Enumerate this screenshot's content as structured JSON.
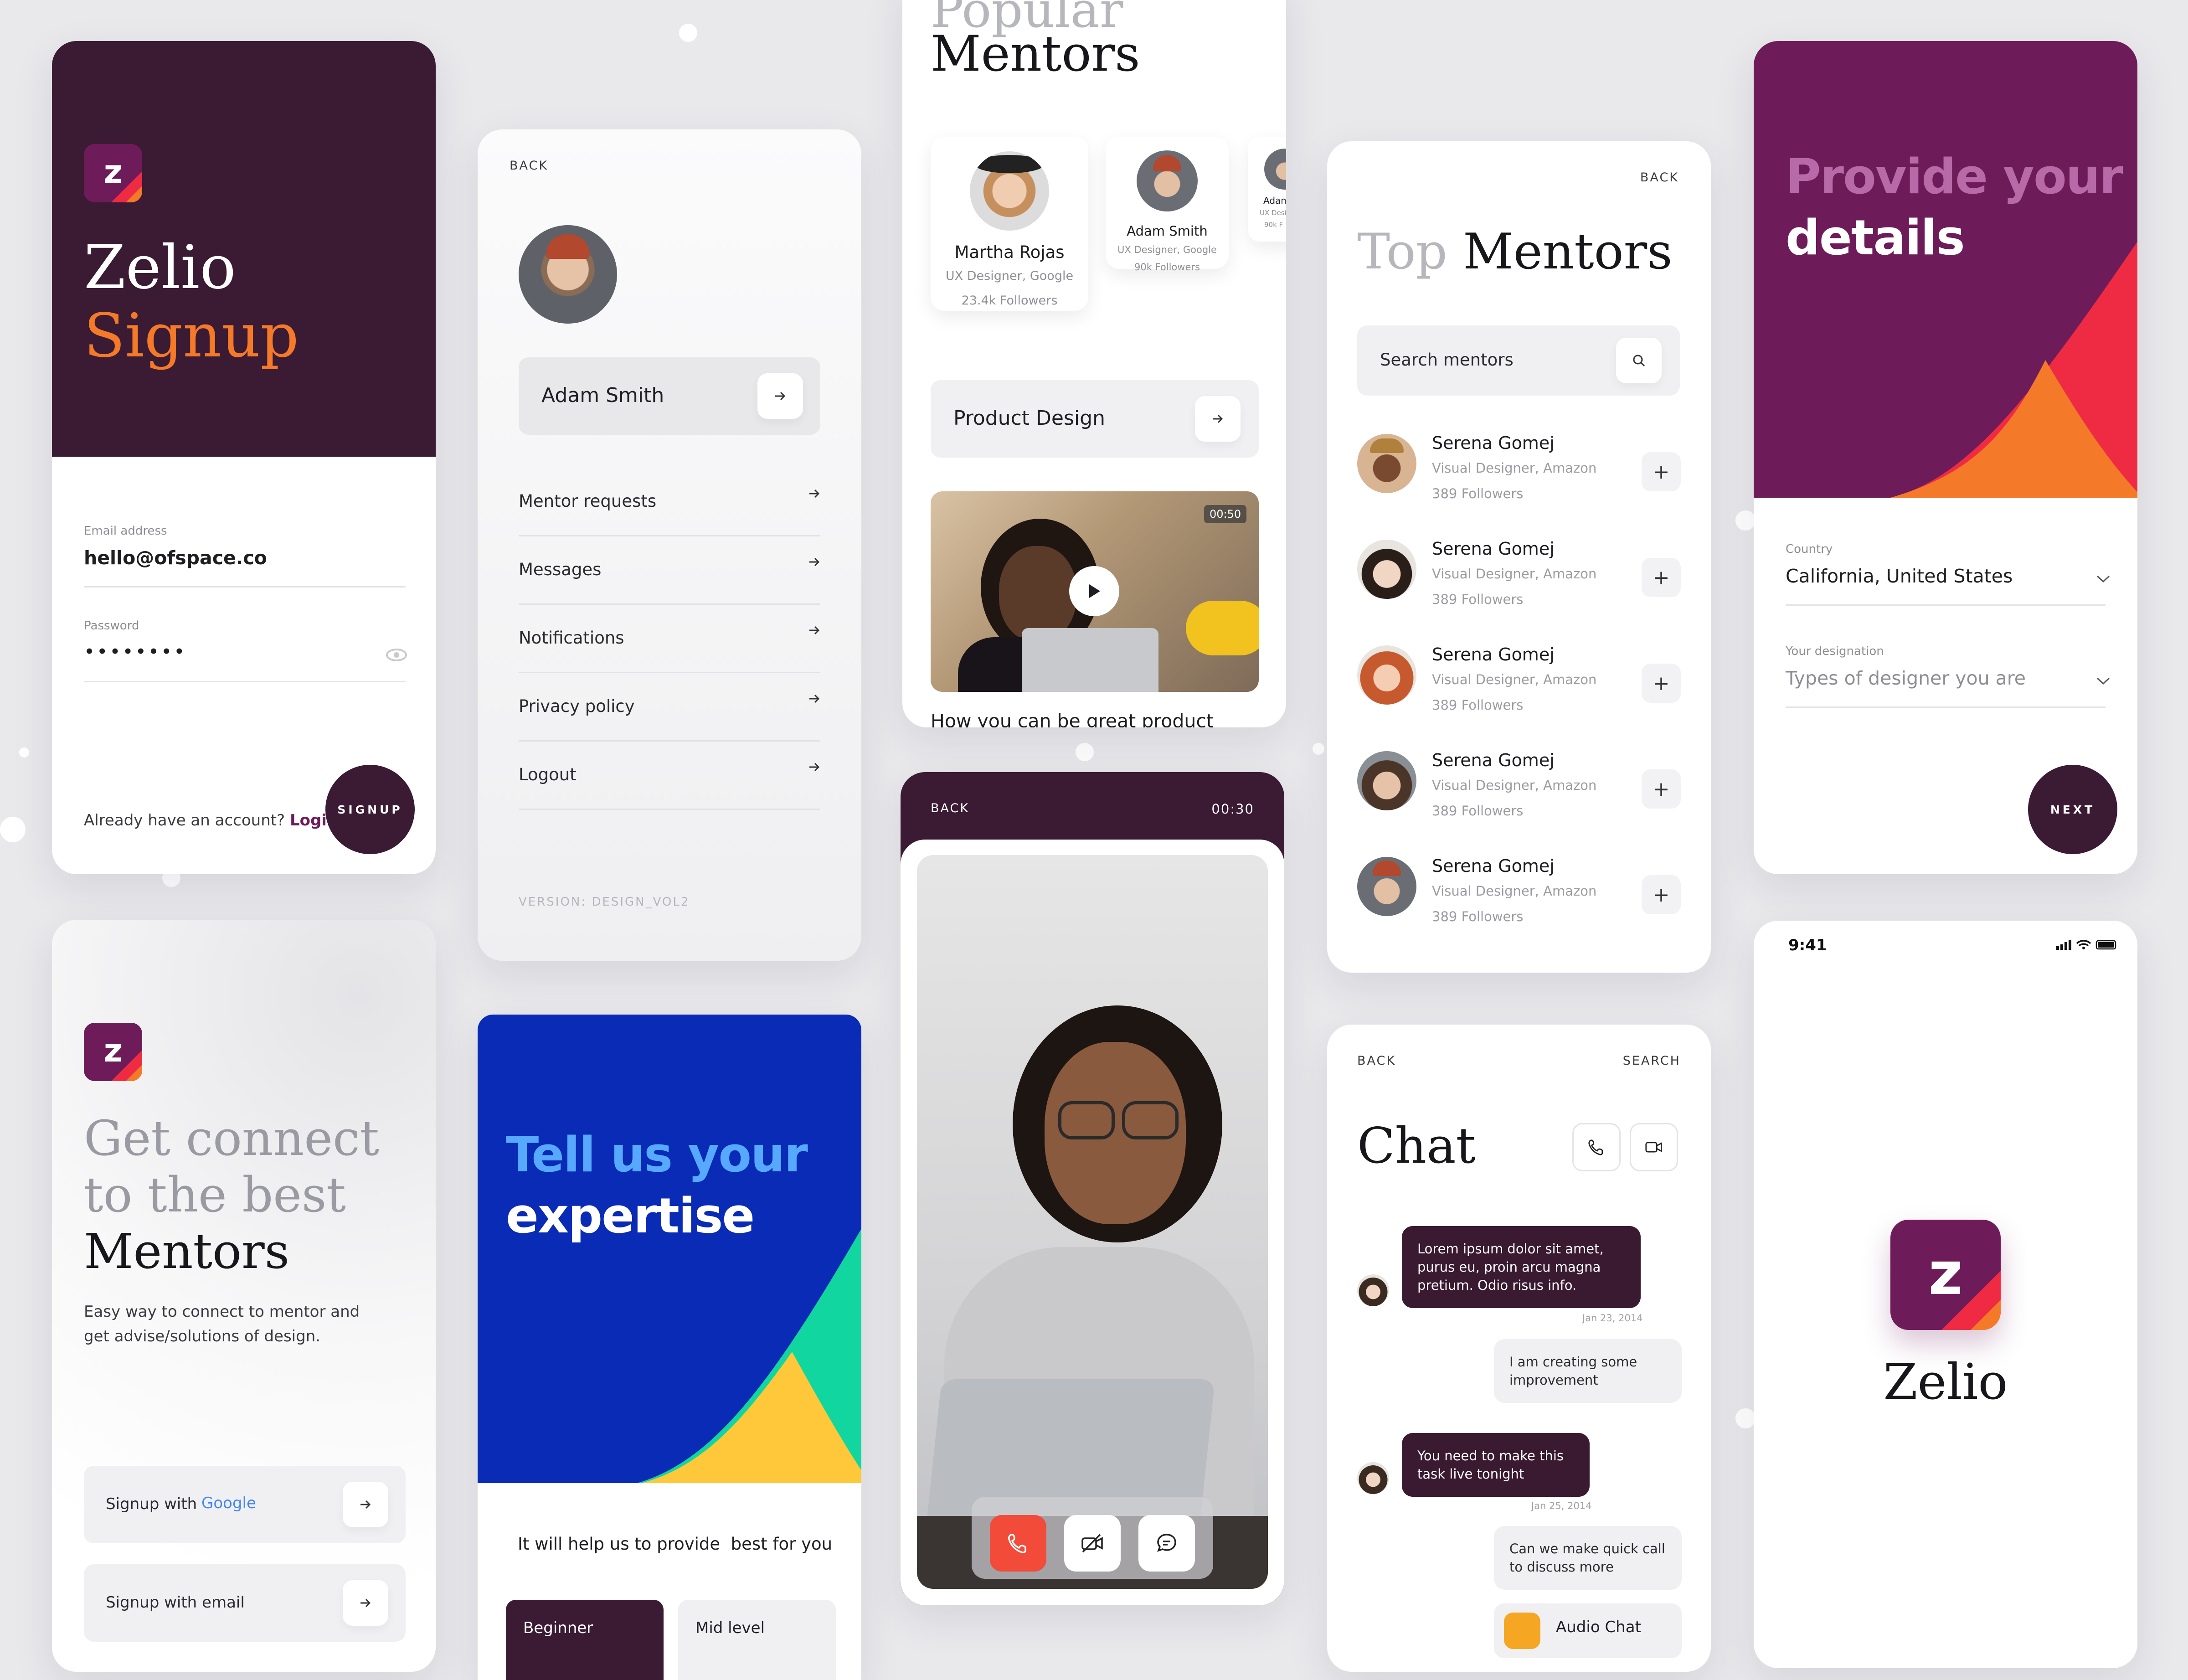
{
  "colors": {
    "plum": "#3b1a33",
    "orange": "#f47a2a",
    "purple": "#6e1b5a",
    "red": "#ef2b43",
    "blue": "#0a2bb5",
    "teal": "#12d6a0",
    "yellow": "#ffc83a",
    "call_red": "#f24b3a"
  },
  "signup": {
    "logo_letter": "z",
    "title_line1": "Zelio",
    "title_line2": "Signup",
    "email_label": "Email address",
    "email_value": "hello@ofspace.co",
    "password_label": "Password",
    "password_value": "••••••••",
    "already_text": "Already have an account?",
    "login_link": "Login",
    "signup_button": "SIGNUP"
  },
  "profile": {
    "back": "BACK",
    "name": "Adam Smith",
    "menu": [
      "Mentor requests",
      "Messages",
      "Notifications",
      "Privacy policy",
      "Logout"
    ],
    "version": "VERSION: DESIGN_VOL2"
  },
  "popular": {
    "heading_partial": "Popular",
    "heading": "Mentors",
    "mentors": [
      {
        "name": "Martha Rojas",
        "role": "UX Designer, Google",
        "followers": "23.4k Followers"
      },
      {
        "name": "Adam Smith",
        "role": "UX Designer, Google",
        "followers": "90k Followers"
      },
      {
        "name": "Adam",
        "role": "UX Desig",
        "followers": "90k F"
      }
    ],
    "category": "Product Design",
    "video_duration": "00:50",
    "video_title": "How you can be great product"
  },
  "top_mentors": {
    "back": "BACK",
    "title_light": "Top",
    "title_dark": "Mentors",
    "search_placeholder": "Search mentors",
    "mentors": [
      {
        "name": "Serena Gomej",
        "role": "Visual Designer, Amazon",
        "followers": "389 Followers"
      },
      {
        "name": "Serena Gomej",
        "role": "Visual Designer, Amazon",
        "followers": "389 Followers"
      },
      {
        "name": "Serena Gomej",
        "role": "Visual Designer, Amazon",
        "followers": "389 Followers"
      },
      {
        "name": "Serena Gomej",
        "role": "Visual Designer, Amazon",
        "followers": "389 Followers"
      },
      {
        "name": "Serena Gomej",
        "role": "Visual Designer, Amazon",
        "followers": "389 Followers"
      }
    ],
    "plus": "+"
  },
  "details": {
    "title_light": "Provide your",
    "title_bold": "details",
    "country_label": "Country",
    "country_value": "California, United States",
    "designation_label": "Your designation",
    "designation_placeholder": "Types of designer you are",
    "next_button": "NEXT"
  },
  "connect": {
    "logo_letter": "z",
    "line1": "Get connect",
    "line2": "to the best",
    "line3": "Mentors",
    "desc_line1": "Easy way to connect to mentor and",
    "desc_line2": "get advise/solutions of design.",
    "google_prefix": "Signup with",
    "google_word": "Google",
    "email_button": "Signup with email"
  },
  "expertise": {
    "title_light": "Tell us your",
    "title_bold": "expertise",
    "subtitle": "It will help us to provide  best for you",
    "levels": [
      "Beginner",
      "Mid level"
    ]
  },
  "video_call": {
    "back": "BACK",
    "timer": "00:30"
  },
  "chat": {
    "back": "BACK",
    "search": "SEARCH",
    "title": "Chat",
    "messages": [
      {
        "side": "left",
        "text": "Lorem ipsum dolor sit amet, purus eu, proin arcu magna pretium. Odio risus info.",
        "date": "Jan 23, 2014"
      },
      {
        "side": "right",
        "text": "I am creating some improvement"
      },
      {
        "side": "left",
        "text": "You need to make this task live tonight",
        "date": "Jan 25, 2014"
      },
      {
        "side": "right",
        "text": "Can we make quick call to discuss more"
      }
    ],
    "audio_chat": "Audio Chat"
  },
  "splash": {
    "time": "9:41",
    "logo_letter": "z",
    "app_name": "Zelio"
  }
}
